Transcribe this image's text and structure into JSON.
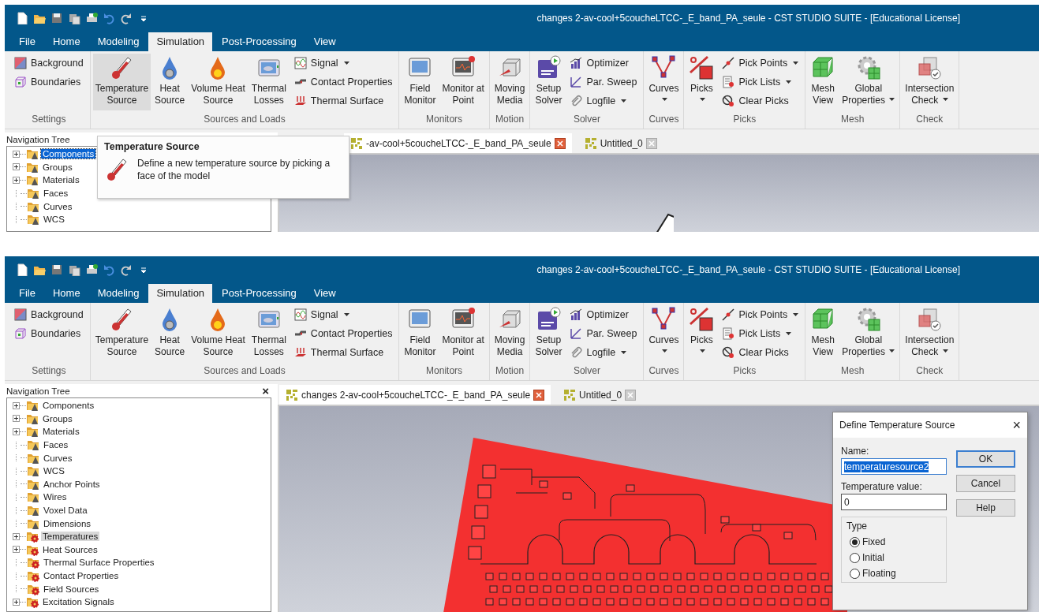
{
  "panels": [
    {
      "window": {
        "title": "changes 2-av-cool+5coucheLTCC-_E_band_PA_seule - CST STUDIO SUITE - [Educational License]"
      },
      "menu_tabs": [
        {
          "label": "File",
          "selected": false
        },
        {
          "label": "Home",
          "selected": false
        },
        {
          "label": "Modeling",
          "selected": false
        },
        {
          "label": "Simulation",
          "selected": true
        },
        {
          "label": "Post-Processing",
          "selected": false
        },
        {
          "label": "View",
          "selected": false
        }
      ],
      "ribbon": [
        {
          "label": "Settings",
          "items": [
            {
              "kind": "small",
              "label": "Background",
              "dropdown": false
            },
            {
              "kind": "small",
              "label": "Boundaries",
              "dropdown": false
            }
          ]
        },
        {
          "label": "Sources and Loads",
          "items": [
            {
              "kind": "large",
              "lines": [
                "Temperature",
                "Source"
              ],
              "dropdown": false,
              "highlighted": true
            },
            {
              "kind": "large",
              "lines": [
                "Heat",
                "Source"
              ],
              "dropdown": false,
              "highlighted": false
            },
            {
              "kind": "large",
              "lines": [
                "Volume Heat",
                "Source"
              ],
              "dropdown": false,
              "highlighted": false
            },
            {
              "kind": "large",
              "lines": [
                "Thermal",
                "Losses"
              ],
              "dropdown": false,
              "highlighted": false
            },
            {
              "kind": "small",
              "label": "Signal",
              "dropdown": true
            },
            {
              "kind": "small",
              "label": "Contact Properties",
              "dropdown": false
            },
            {
              "kind": "small",
              "label": "Thermal Surface",
              "dropdown": false
            }
          ]
        },
        {
          "label": "Monitors",
          "items": [
            {
              "kind": "large",
              "lines": [
                "Field",
                "Monitor"
              ],
              "dropdown": false,
              "highlighted": false
            },
            {
              "kind": "large",
              "lines": [
                "Monitor at",
                "Point"
              ],
              "dropdown": false,
              "highlighted": false
            }
          ]
        },
        {
          "label": "Motion",
          "items": [
            {
              "kind": "large",
              "lines": [
                "Moving",
                "Media"
              ],
              "dropdown": false,
              "highlighted": false
            }
          ]
        },
        {
          "label": "Solver",
          "items": [
            {
              "kind": "large",
              "lines": [
                "Setup",
                "Solver"
              ],
              "dropdown": false,
              "highlighted": false
            },
            {
              "kind": "small",
              "label": "Optimizer",
              "dropdown": false
            },
            {
              "kind": "small",
              "label": "Par. Sweep",
              "dropdown": false
            },
            {
              "kind": "small",
              "label": "Logfile",
              "dropdown": true
            }
          ]
        },
        {
          "label": "Curves",
          "items": [
            {
              "kind": "large",
              "lines": [
                "Curves"
              ],
              "dropdown": true,
              "highlighted": false
            }
          ]
        },
        {
          "label": "Picks",
          "items": [
            {
              "kind": "large",
              "lines": [
                "Picks"
              ],
              "dropdown": true,
              "highlighted": false
            },
            {
              "kind": "small",
              "label": "Pick Points",
              "dropdown": true
            },
            {
              "kind": "small",
              "label": "Pick Lists",
              "dropdown": true
            },
            {
              "kind": "small",
              "label": "Clear Picks",
              "dropdown": false
            }
          ]
        },
        {
          "label": "Mesh",
          "items": [
            {
              "kind": "large",
              "lines": [
                "Mesh",
                "View"
              ],
              "dropdown": false,
              "highlighted": false
            },
            {
              "kind": "large",
              "lines": [
                "Global",
                "Properties"
              ],
              "dropdown": true,
              "highlighted": false
            }
          ]
        },
        {
          "label": "Check",
          "items": [
            {
              "kind": "large",
              "lines": [
                "Intersection",
                "Check"
              ],
              "dropdown": true,
              "highlighted": false
            }
          ]
        }
      ],
      "nav_tree": {
        "title": "Navigation Tree",
        "focused": true,
        "items": [
          {
            "label": "Components",
            "kind": "model",
            "expandable": true,
            "selected": true
          },
          {
            "label": "Groups",
            "kind": "model",
            "expandable": true,
            "selected": false
          },
          {
            "label": "Materials",
            "kind": "model",
            "expandable": true,
            "selected": false
          },
          {
            "label": "Faces",
            "kind": "model",
            "expandable": false,
            "selected": false
          },
          {
            "label": "Curves",
            "kind": "model",
            "expandable": false,
            "selected": false
          },
          {
            "label": "WCS",
            "kind": "model",
            "expandable": false,
            "selected": false
          }
        ]
      },
      "doc_tabs": [
        {
          "label": "-av-cool+5coucheLTCC-_E_band_PA_seule",
          "selected": true
        },
        {
          "label": "Untitled_0",
          "selected": false
        }
      ],
      "viewport": {
        "kind": "outline"
      },
      "tooltip": {
        "title": "Temperature Source",
        "text": "Define a new temperature source by picking a face of the model"
      }
    },
    {
      "window": {
        "title": "changes 2-av-cool+5coucheLTCC-_E_band_PA_seule - CST STUDIO SUITE - [Educational License]"
      },
      "menu_tabs": [
        {
          "label": "File",
          "selected": false
        },
        {
          "label": "Home",
          "selected": false
        },
        {
          "label": "Modeling",
          "selected": false
        },
        {
          "label": "Simulation",
          "selected": true
        },
        {
          "label": "Post-Processing",
          "selected": false
        },
        {
          "label": "View",
          "selected": false
        }
      ],
      "ribbon": [
        {
          "label": "Settings",
          "items": [
            {
              "kind": "small",
              "label": "Background",
              "dropdown": false
            },
            {
              "kind": "small",
              "label": "Boundaries",
              "dropdown": false
            }
          ]
        },
        {
          "label": "Sources and Loads",
          "items": [
            {
              "kind": "large",
              "lines": [
                "Temperature",
                "Source"
              ],
              "dropdown": false,
              "highlighted": false
            },
            {
              "kind": "large",
              "lines": [
                "Heat",
                "Source"
              ],
              "dropdown": false,
              "highlighted": false
            },
            {
              "kind": "large",
              "lines": [
                "Volume Heat",
                "Source"
              ],
              "dropdown": false,
              "highlighted": false
            },
            {
              "kind": "large",
              "lines": [
                "Thermal",
                "Losses"
              ],
              "dropdown": false,
              "highlighted": false
            },
            {
              "kind": "small",
              "label": "Signal",
              "dropdown": true
            },
            {
              "kind": "small",
              "label": "Contact Properties",
              "dropdown": false
            },
            {
              "kind": "small",
              "label": "Thermal Surface",
              "dropdown": false
            }
          ]
        },
        {
          "label": "Monitors",
          "items": [
            {
              "kind": "large",
              "lines": [
                "Field",
                "Monitor"
              ],
              "dropdown": false,
              "highlighted": false
            },
            {
              "kind": "large",
              "lines": [
                "Monitor at",
                "Point"
              ],
              "dropdown": false,
              "highlighted": false
            }
          ]
        },
        {
          "label": "Motion",
          "items": [
            {
              "kind": "large",
              "lines": [
                "Moving",
                "Media"
              ],
              "dropdown": false,
              "highlighted": false
            }
          ]
        },
        {
          "label": "Solver",
          "items": [
            {
              "kind": "large",
              "lines": [
                "Setup",
                "Solver"
              ],
              "dropdown": false,
              "highlighted": false
            },
            {
              "kind": "small",
              "label": "Optimizer",
              "dropdown": false
            },
            {
              "kind": "small",
              "label": "Par. Sweep",
              "dropdown": false
            },
            {
              "kind": "small",
              "label": "Logfile",
              "dropdown": true
            }
          ]
        },
        {
          "label": "Curves",
          "items": [
            {
              "kind": "large",
              "lines": [
                "Curves"
              ],
              "dropdown": true,
              "highlighted": false
            }
          ]
        },
        {
          "label": "Picks",
          "items": [
            {
              "kind": "large",
              "lines": [
                "Picks"
              ],
              "dropdown": true,
              "highlighted": false
            },
            {
              "kind": "small",
              "label": "Pick Points",
              "dropdown": true
            },
            {
              "kind": "small",
              "label": "Pick Lists",
              "dropdown": true
            },
            {
              "kind": "small",
              "label": "Clear Picks",
              "dropdown": false
            }
          ]
        },
        {
          "label": "Mesh",
          "items": [
            {
              "kind": "large",
              "lines": [
                "Mesh",
                "View"
              ],
              "dropdown": false,
              "highlighted": false
            },
            {
              "kind": "large",
              "lines": [
                "Global",
                "Properties"
              ],
              "dropdown": true,
              "highlighted": false
            }
          ]
        },
        {
          "label": "Check",
          "items": [
            {
              "kind": "large",
              "lines": [
                "Intersection",
                "Check"
              ],
              "dropdown": true,
              "highlighted": false
            }
          ]
        }
      ],
      "nav_tree": {
        "title": "Navigation Tree",
        "close": "×",
        "focused": false,
        "items": [
          {
            "label": "Components",
            "kind": "model",
            "expandable": true,
            "selected": false
          },
          {
            "label": "Groups",
            "kind": "model",
            "expandable": true,
            "selected": false
          },
          {
            "label": "Materials",
            "kind": "model",
            "expandable": true,
            "selected": false
          },
          {
            "label": "Faces",
            "kind": "model",
            "expandable": false,
            "selected": false
          },
          {
            "label": "Curves",
            "kind": "model",
            "expandable": false,
            "selected": false
          },
          {
            "label": "WCS",
            "kind": "model",
            "expandable": false,
            "selected": false
          },
          {
            "label": "Anchor Points",
            "kind": "model",
            "expandable": false,
            "selected": false
          },
          {
            "label": "Wires",
            "kind": "model",
            "expandable": false,
            "selected": false
          },
          {
            "label": "Voxel Data",
            "kind": "model",
            "expandable": false,
            "selected": false
          },
          {
            "label": "Dimensions",
            "kind": "model",
            "expandable": false,
            "selected": false
          },
          {
            "label": "Temperatures",
            "kind": "thermal",
            "expandable": true,
            "selected": true
          },
          {
            "label": "Heat Sources",
            "kind": "thermal",
            "expandable": true,
            "selected": false
          },
          {
            "label": "Thermal Surface Properties",
            "kind": "thermal",
            "expandable": false,
            "selected": false
          },
          {
            "label": "Contact Properties",
            "kind": "thermal",
            "expandable": false,
            "selected": false
          },
          {
            "label": "Field Sources",
            "kind": "thermal",
            "expandable": false,
            "selected": false
          },
          {
            "label": "Excitation Signals",
            "kind": "thermal",
            "expandable": true,
            "selected": false
          }
        ]
      },
      "doc_tabs": [
        {
          "label": "changes 2-av-cool+5coucheLTCC-_E_band_PA_seule",
          "selected": true
        },
        {
          "label": "Untitled_0",
          "selected": false
        }
      ],
      "viewport": {
        "kind": "board"
      },
      "dialog": {
        "title": "Define Temperature Source",
        "close": "×",
        "fields": [
          {
            "label": "Name:",
            "value": "temperaturesource2",
            "text_selected": true
          },
          {
            "label": "Temperature value:",
            "value": "0",
            "text_selected": false
          }
        ],
        "type_group": {
          "title": "Type",
          "options": [
            {
              "label": "Fixed",
              "selected": true
            },
            {
              "label": "Initial",
              "selected": false
            },
            {
              "label": "Floating",
              "selected": false
            }
          ]
        },
        "buttons": [
          {
            "label": "OK",
            "default": true
          },
          {
            "label": "Cancel",
            "default": false
          },
          {
            "label": "Help",
            "default": false
          }
        ]
      }
    }
  ]
}
